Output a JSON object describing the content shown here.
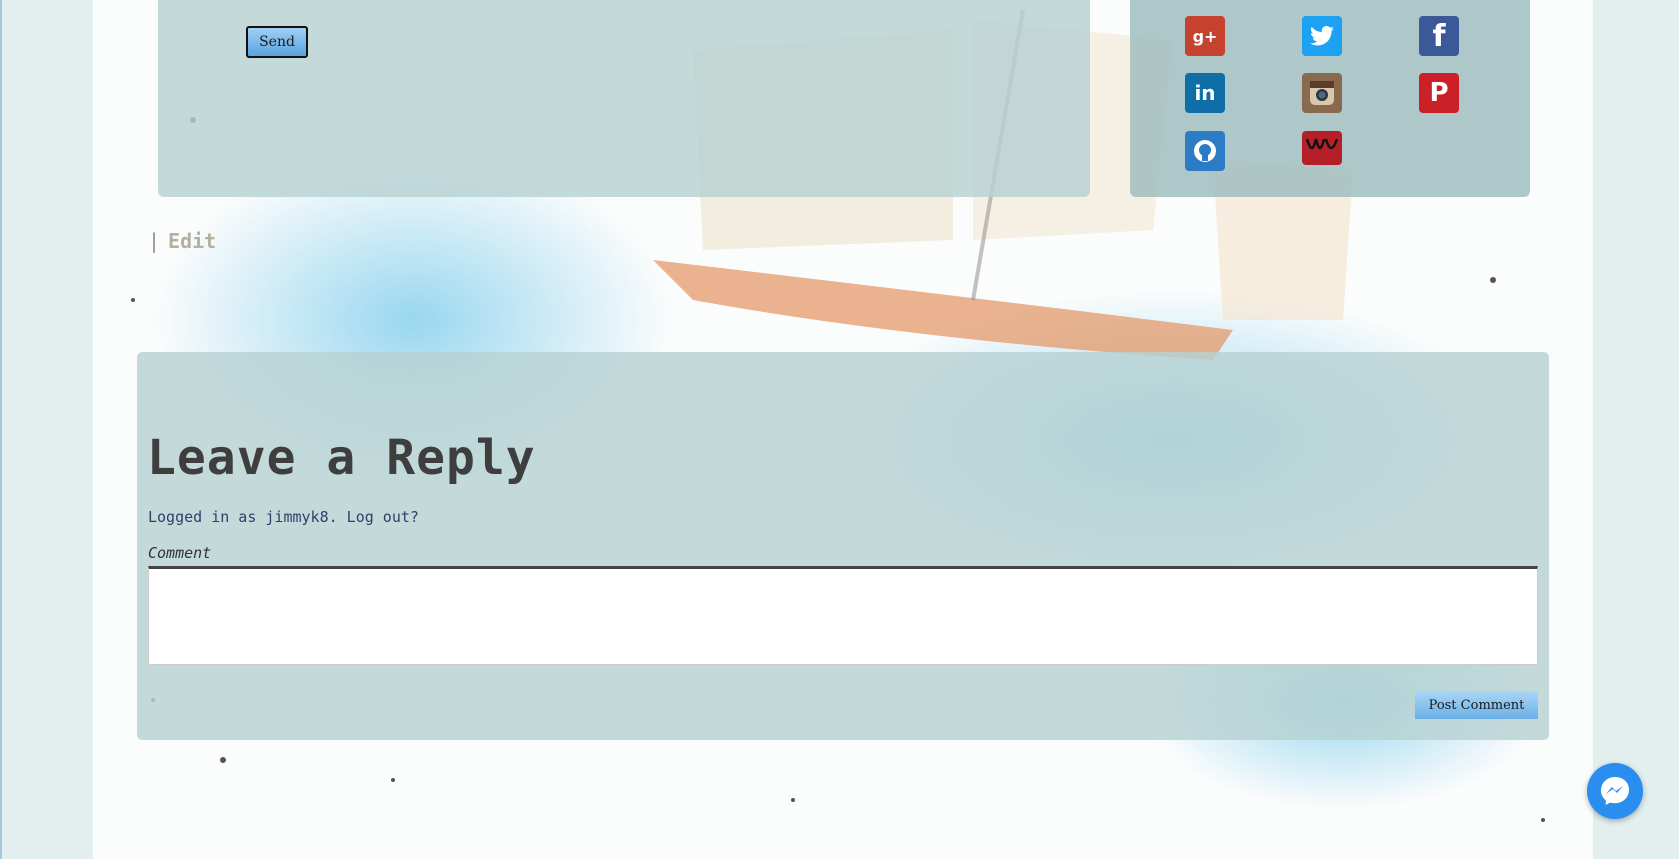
{
  "contact": {
    "send_label": "Send"
  },
  "social": {
    "icons": [
      "google-plus-icon",
      "twitter-icon",
      "facebook-icon",
      "linkedin-icon",
      "instagram-icon",
      "pinterest-icon",
      "github-icon",
      "custom-logo-icon"
    ]
  },
  "post": {
    "edit_separator": "|",
    "edit_label": "Edit"
  },
  "reply": {
    "title": "Leave a Reply",
    "logged_in_text": "Logged in as jimmyk8. Log out?",
    "comment_label": "Comment",
    "comment_value": "",
    "post_button": "Post Comment"
  },
  "colors": {
    "accent": "#2a8df0",
    "panel": "#b7d2d2",
    "page_bg": "#e3eeee"
  }
}
